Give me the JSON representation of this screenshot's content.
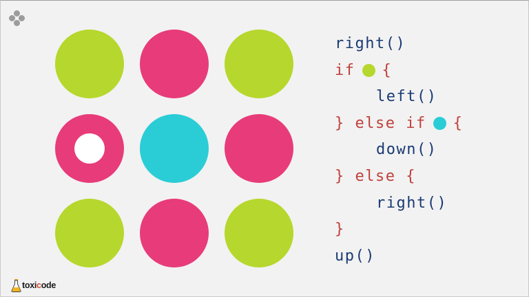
{
  "colors": {
    "green": "#b6d72d",
    "pink": "#e83b79",
    "cyan": "#2acdd6",
    "marker": "#ffffff",
    "function_text": "#1b3a74",
    "keyword_text": "#c0403b"
  },
  "menu": {
    "icon": "menu-dots-icon"
  },
  "grid": {
    "rows": 3,
    "cols": 3,
    "cells": [
      [
        "green",
        "pink",
        "green"
      ],
      [
        "pink",
        "cyan",
        "pink"
      ],
      [
        "green",
        "pink",
        "green"
      ]
    ],
    "marker_position": {
      "row": 2,
      "col": 1
    }
  },
  "code": {
    "lines": [
      {
        "text": "right()",
        "type": "call",
        "indent": 0
      },
      {
        "keyword": "if",
        "condition_color": "green",
        "brace": "{",
        "type": "if",
        "indent": 0
      },
      {
        "text": "left()",
        "type": "call",
        "indent": 1
      },
      {
        "prefix": "} else if",
        "condition_color": "cyan",
        "brace": "{",
        "type": "elseif",
        "indent": 0
      },
      {
        "text": "down()",
        "type": "call",
        "indent": 1
      },
      {
        "text": "} else {",
        "type": "keyword",
        "indent": 0
      },
      {
        "text": "right()",
        "type": "call",
        "indent": 1
      },
      {
        "text": "}",
        "type": "keyword",
        "indent": 0
      },
      {
        "text": "up()",
        "type": "call",
        "indent": 0
      }
    ]
  },
  "logo": {
    "prefix": "toxi",
    "accent": "c",
    "suffix": "ode",
    "icon": "flask-icon"
  }
}
